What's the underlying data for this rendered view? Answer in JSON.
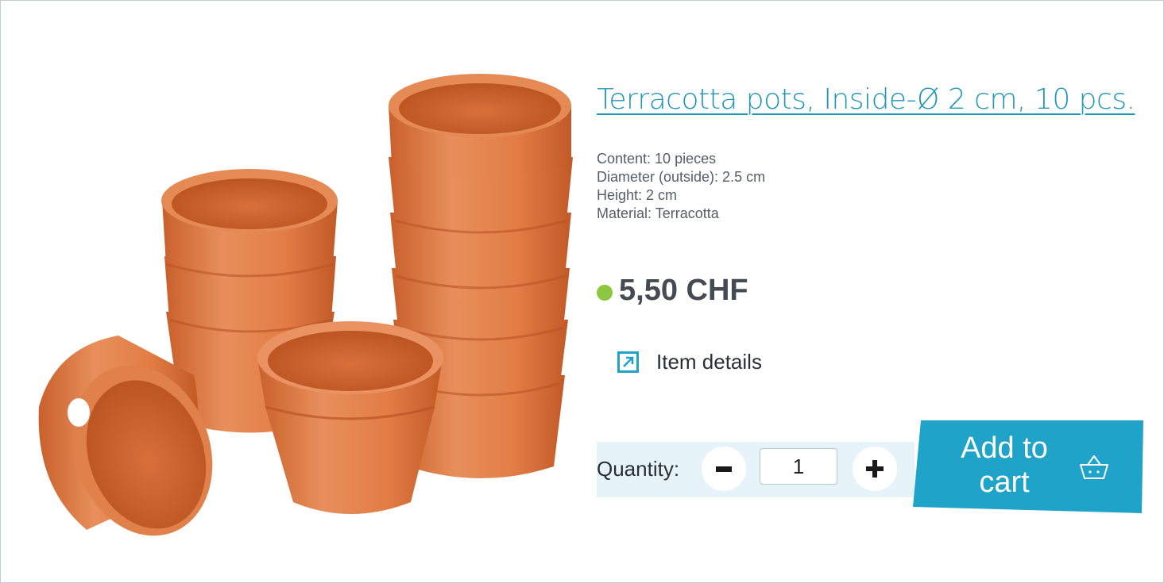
{
  "product": {
    "title": "Terracotta pots, Inside-Ø 2 cm, 10 pcs.",
    "specs": [
      "Content: 10 pieces",
      "Diameter (outside): 2.5 cm",
      "Height: 2 cm",
      "Material: Terracotta"
    ],
    "price": "5,50 CHF",
    "details_label": "Item details"
  },
  "purchase": {
    "quantity_label": "Quantity:",
    "quantity_value": "1",
    "add_to_cart_label": "Add to cart"
  },
  "icons": {
    "availability": "availability-dot-icon",
    "details": "external-link-arrow-icon",
    "decrease": "minus-icon",
    "increase": "plus-icon",
    "cart": "shopping-basket-icon"
  },
  "colors": {
    "accent": "#1fa3c9",
    "title": "#1f97b8",
    "in_stock": "#8dc63f",
    "quantity_bar": "#e6f4fa",
    "terracotta": "#e07b45"
  }
}
